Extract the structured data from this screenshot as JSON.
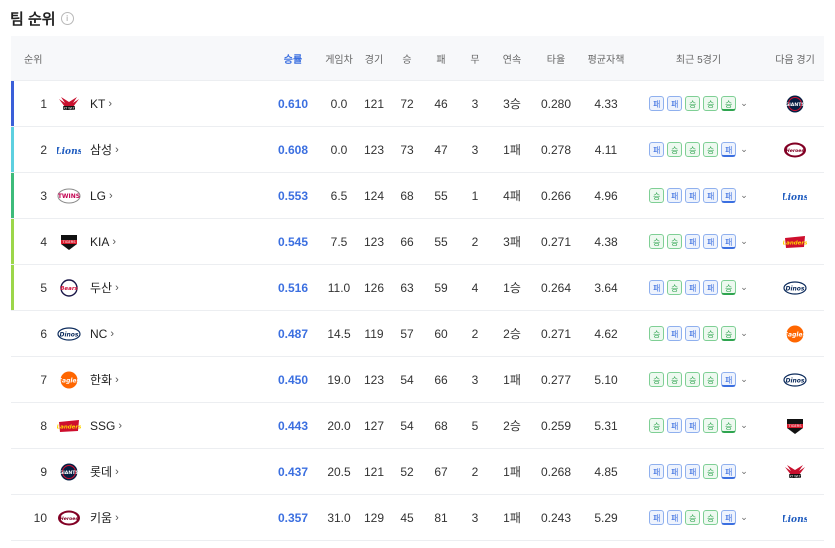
{
  "page": {
    "title": "팀 순위",
    "info_icon": "i"
  },
  "headers": {
    "rank": "순위",
    "pct": "승률",
    "gb": "게임차",
    "games": "경기",
    "wins": "승",
    "losses": "패",
    "draws": "무",
    "streak": "연속",
    "avg": "타율",
    "era": "평균자책",
    "last5": "최근 5경기",
    "next": "다음 경기"
  },
  "colors": {
    "accent": "#3b6fe0",
    "win": "#2ea44f"
  },
  "teams": [
    {
      "rank": "1",
      "name": "KT",
      "logo": "wiz",
      "pct": "0.610",
      "gb": "0.0",
      "games": "121",
      "wins": "72",
      "losses": "46",
      "draws": "3",
      "streak": "3승",
      "avg": "0.280",
      "era": "4.33",
      "last5": [
        "패",
        "패",
        "승",
        "승",
        "승"
      ],
      "next": "giants",
      "bar": "#3a5fd9"
    },
    {
      "rank": "2",
      "name": "삼성",
      "logo": "lions",
      "pct": "0.608",
      "gb": "0.0",
      "games": "123",
      "wins": "73",
      "losses": "47",
      "draws": "3",
      "streak": "1패",
      "avg": "0.278",
      "era": "4.11",
      "last5": [
        "패",
        "승",
        "승",
        "승",
        "패"
      ],
      "next": "heroes",
      "bar": "#5dd0e0"
    },
    {
      "rank": "3",
      "name": "LG",
      "logo": "twins",
      "pct": "0.553",
      "gb": "6.5",
      "games": "124",
      "wins": "68",
      "losses": "55",
      "draws": "1",
      "streak": "4패",
      "avg": "0.266",
      "era": "4.96",
      "last5": [
        "승",
        "패",
        "패",
        "패",
        "패"
      ],
      "next": "lions",
      "bar": "#3dbb7a"
    },
    {
      "rank": "4",
      "name": "KIA",
      "logo": "tigers",
      "pct": "0.545",
      "gb": "7.5",
      "games": "123",
      "wins": "66",
      "losses": "55",
      "draws": "2",
      "streak": "3패",
      "avg": "0.271",
      "era": "4.38",
      "last5": [
        "승",
        "승",
        "패",
        "패",
        "패"
      ],
      "next": "landers",
      "bar": "#9cd64a"
    },
    {
      "rank": "5",
      "name": "두산",
      "logo": "bears",
      "pct": "0.516",
      "gb": "11.0",
      "games": "126",
      "wins": "63",
      "losses": "59",
      "draws": "4",
      "streak": "1승",
      "avg": "0.264",
      "era": "3.64",
      "last5": [
        "패",
        "승",
        "패",
        "패",
        "승"
      ],
      "next": "dinos",
      "bar": "#9cd64a"
    },
    {
      "rank": "6",
      "name": "NC",
      "logo": "dinos",
      "pct": "0.487",
      "gb": "14.5",
      "games": "119",
      "wins": "57",
      "losses": "60",
      "draws": "2",
      "streak": "2승",
      "avg": "0.271",
      "era": "4.62",
      "last5": [
        "승",
        "패",
        "패",
        "승",
        "승"
      ],
      "next": "eagles",
      "bar": ""
    },
    {
      "rank": "7",
      "name": "한화",
      "logo": "eagles",
      "pct": "0.450",
      "gb": "19.0",
      "games": "123",
      "wins": "54",
      "losses": "66",
      "draws": "3",
      "streak": "1패",
      "avg": "0.277",
      "era": "5.10",
      "last5": [
        "승",
        "승",
        "승",
        "승",
        "패"
      ],
      "next": "dinos",
      "bar": ""
    },
    {
      "rank": "8",
      "name": "SSG",
      "logo": "landers",
      "pct": "0.443",
      "gb": "20.0",
      "games": "127",
      "wins": "54",
      "losses": "68",
      "draws": "5",
      "streak": "2승",
      "avg": "0.259",
      "era": "5.31",
      "last5": [
        "승",
        "패",
        "패",
        "승",
        "승"
      ],
      "next": "tigers",
      "bar": ""
    },
    {
      "rank": "9",
      "name": "롯데",
      "logo": "giants",
      "pct": "0.437",
      "gb": "20.5",
      "games": "121",
      "wins": "52",
      "losses": "67",
      "draws": "2",
      "streak": "1패",
      "avg": "0.268",
      "era": "4.85",
      "last5": [
        "패",
        "패",
        "패",
        "승",
        "패"
      ],
      "next": "wiz",
      "bar": ""
    },
    {
      "rank": "10",
      "name": "키움",
      "logo": "heroes",
      "pct": "0.357",
      "gb": "31.0",
      "games": "129",
      "wins": "45",
      "losses": "81",
      "draws": "3",
      "streak": "1패",
      "avg": "0.243",
      "era": "5.29",
      "last5": [
        "패",
        "패",
        "승",
        "승",
        "패"
      ],
      "next": "lions",
      "bar": ""
    }
  ]
}
